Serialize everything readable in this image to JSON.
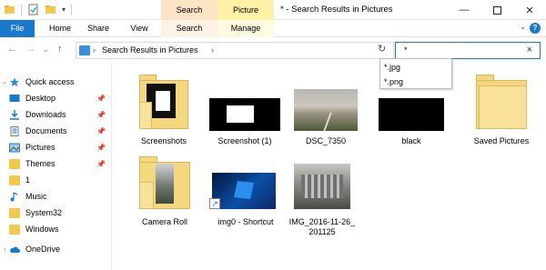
{
  "titlebar": {
    "title": "* - Search Results in Pictures",
    "context_tabs": [
      "Search Tools",
      "Picture Tools"
    ]
  },
  "ribbon": {
    "file": "File",
    "home": "Home",
    "share": "Share",
    "view": "View",
    "search": "Search",
    "manage": "Manage"
  },
  "address": {
    "path": "Search Results in Pictures"
  },
  "search": {
    "value": "*",
    "suggestions": [
      "*.jpg",
      "*.png"
    ]
  },
  "sidebar": {
    "items": [
      {
        "label": "Quick access",
        "icon": "star-icon",
        "pinned": false
      },
      {
        "label": "Desktop",
        "icon": "desktop-icon",
        "pinned": true
      },
      {
        "label": "Downloads",
        "icon": "download-icon",
        "pinned": true
      },
      {
        "label": "Documents",
        "icon": "documents-icon",
        "pinned": true
      },
      {
        "label": "Pictures",
        "icon": "pictures-icon",
        "pinned": true
      },
      {
        "label": "Themes",
        "icon": "folder-icon",
        "pinned": true
      },
      {
        "label": "1",
        "icon": "folder-icon",
        "pinned": false
      },
      {
        "label": "Music",
        "icon": "music-icon",
        "pinned": false
      },
      {
        "label": "System32",
        "icon": "folder-icon",
        "pinned": false
      },
      {
        "label": "Windows",
        "icon": "folder-icon",
        "pinned": false
      },
      {
        "label": "OneDrive",
        "icon": "cloud-icon",
        "pinned": false
      }
    ]
  },
  "files": [
    {
      "name": "Screenshots",
      "kind": "folder"
    },
    {
      "name": "Screenshot (1)",
      "kind": "image"
    },
    {
      "name": "DSC_7350",
      "kind": "image"
    },
    {
      "name": "black",
      "kind": "image"
    },
    {
      "name": "Saved Pictures",
      "kind": "folder"
    },
    {
      "name": "Camera Roll",
      "kind": "folder"
    },
    {
      "name": "img0 - Shortcut",
      "kind": "shortcut"
    },
    {
      "name": "IMG_2016-11-26_ 201125",
      "kind": "image"
    }
  ],
  "colors": {
    "accent": "#1979ca",
    "search_tools": "#fce4c4",
    "picture_tools": "#fff2a8",
    "folder": "#f5d77e"
  }
}
